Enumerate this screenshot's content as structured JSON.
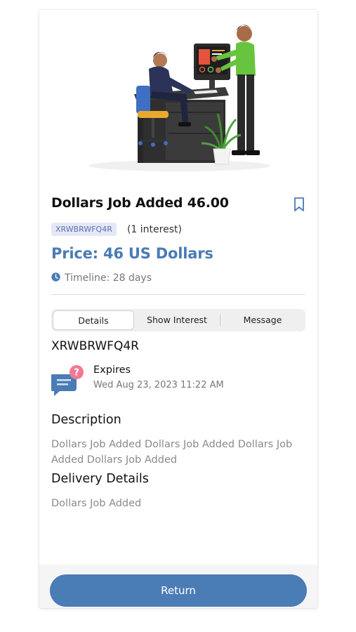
{
  "job": {
    "title": "Dollars Job Added 46.00",
    "code_badge": "XRWBRWFQ4R",
    "interest_text": "(1 interest)",
    "price": "Price: 46 US Dollars",
    "timeline": "Timeline: 28 days",
    "code_heading": "XRWBRWFQ4R"
  },
  "tabs": [
    {
      "label": "Details",
      "active": true
    },
    {
      "label": "Show Interest",
      "active": false
    },
    {
      "label": "Message",
      "active": false
    }
  ],
  "expires": {
    "label": "Expires",
    "date": "Wed Aug 23, 2023 11:22 AM"
  },
  "description": {
    "heading": "Description",
    "text": "Dollars Job Added Dollars Job Added Dollars Job Added Dollars Job Added"
  },
  "delivery": {
    "heading": "Delivery Details",
    "text": "Dollars Job Added"
  },
  "footer": {
    "return_label": "Return"
  },
  "colors": {
    "accent": "#4a7cb5",
    "badge_bg": "#e4e8f6",
    "badge_text": "#5b6fb0",
    "muted_text": "#8a8a8a"
  },
  "icons": {
    "bookmark": "bookmark-icon",
    "clock": "clock-icon",
    "expires": "chat-question-icon"
  }
}
